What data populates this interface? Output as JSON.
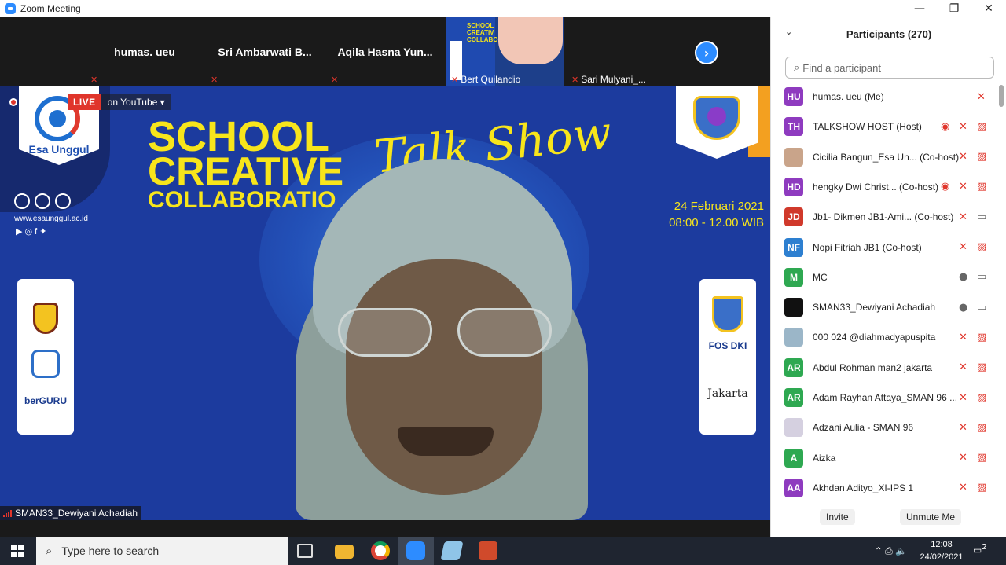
{
  "window": {
    "title": "Zoom Meeting",
    "minimize": "—",
    "maximize": "❐",
    "close": "✕"
  },
  "gallery": [
    {
      "name": "humas. ueu",
      "mute": "✕"
    },
    {
      "name": "Sri Ambarwati B...",
      "mute": "✕"
    },
    {
      "name": "Aqila Hasna Yun...",
      "mute": "✕"
    },
    {
      "name": "Bert Quilandio",
      "mute": "✕",
      "poster": "SCHOOL CREATIV COLLABORA"
    },
    {
      "name": "Sari Mulyani_...",
      "mute": "✕"
    }
  ],
  "gallery_next": "›",
  "main_video": {
    "live_label": "LIVE",
    "platform": "on YouTube",
    "platform_caret": "▾",
    "brand": "Esa Unggul",
    "url": "www.esaunggul.ac.id",
    "social": "▶  ◎  f  ✦",
    "headline_1": "SCHOOL",
    "headline_2": "CREATIVE",
    "headline_3": "COLLABORATIO",
    "script_text": "Talk Show",
    "date_line": "24 Februari 2021",
    "time_line": "08:00 - 12.00 WIB",
    "left_card_label": "berGURU",
    "right_card_label_1": "FOS DKI",
    "right_card_label_2": "Jakarta",
    "speaker_name": "SMAN33_Dewiyani Achadiah"
  },
  "participants_panel": {
    "title": "Participants (270)",
    "collapse_icon": "⌄",
    "search_placeholder": "Find a participant",
    "search_icon": "⌕",
    "invite": "Invite",
    "unmute_me": "Unmute Me",
    "list": [
      {
        "initials": "HU",
        "color": "#8e3bbf",
        "name": "humas. ueu (Me)",
        "icons": [
          "mic-off"
        ]
      },
      {
        "initials": "TH",
        "color": "#8e3bbf",
        "name": "TALKSHOW HOST (Host)",
        "icons": [
          "record",
          "mic-off",
          "cam-off"
        ]
      },
      {
        "initials": "",
        "color": "#c9a48a",
        "name": "Cicilia Bangun_Esa Un...  (Co-host)",
        "icons": [
          "mic-off",
          "cam-off"
        ]
      },
      {
        "initials": "HD",
        "color": "#8e3bbf",
        "name": "hengky Dwi Christ...  (Co-host)",
        "icons": [
          "record",
          "mic-off",
          "cam-off"
        ]
      },
      {
        "initials": "JD",
        "color": "#d0392b",
        "name": "Jb1- Dikmen JB1-Ami...  (Co-host)",
        "icons": [
          "mic-off",
          "cam-on"
        ]
      },
      {
        "initials": "NF",
        "color": "#2d7fd0",
        "name": "Nopi Fitriah JB1 (Co-host)",
        "icons": [
          "mic-off",
          "cam-off"
        ]
      },
      {
        "initials": "M",
        "color": "#2ea851",
        "name": "MC",
        "icons": [
          "mic-on",
          "cam-on"
        ]
      },
      {
        "initials": "",
        "color": "#111111",
        "name": "SMAN33_Dewiyani Achadiah",
        "icons": [
          "mic-on",
          "cam-on"
        ]
      },
      {
        "initials": "",
        "color": "#9bb6c8",
        "name": "000 024 @diahmadyapuspita",
        "icons": [
          "mic-off",
          "cam-off"
        ]
      },
      {
        "initials": "AR",
        "color": "#2ea851",
        "name": "Abdul Rohman man2 jakarta",
        "icons": [
          "mic-off",
          "cam-off"
        ]
      },
      {
        "initials": "AR",
        "color": "#2ea851",
        "name": "Adam Rayhan Attaya_SMAN 96 ...",
        "icons": [
          "mic-off",
          "cam-off"
        ]
      },
      {
        "initials": "",
        "color": "#d5d0e0",
        "name": "Adzani Aulia - SMAN 96",
        "icons": [
          "mic-off",
          "cam-off"
        ]
      },
      {
        "initials": "A",
        "color": "#2ea851",
        "name": "Aizka",
        "icons": [
          "mic-off",
          "cam-off"
        ]
      },
      {
        "initials": "AA",
        "color": "#8e3bbf",
        "name": "Akhdan Adityo_XI-IPS 1",
        "icons": [
          "mic-off",
          "cam-off"
        ]
      }
    ]
  },
  "taskbar": {
    "search_placeholder": "Type here to search",
    "search_icon": "⌕",
    "time": "12:08",
    "date": "24/02/2021",
    "tray_icons": "⌃  ⎙  🔈",
    "notifications": "2"
  }
}
